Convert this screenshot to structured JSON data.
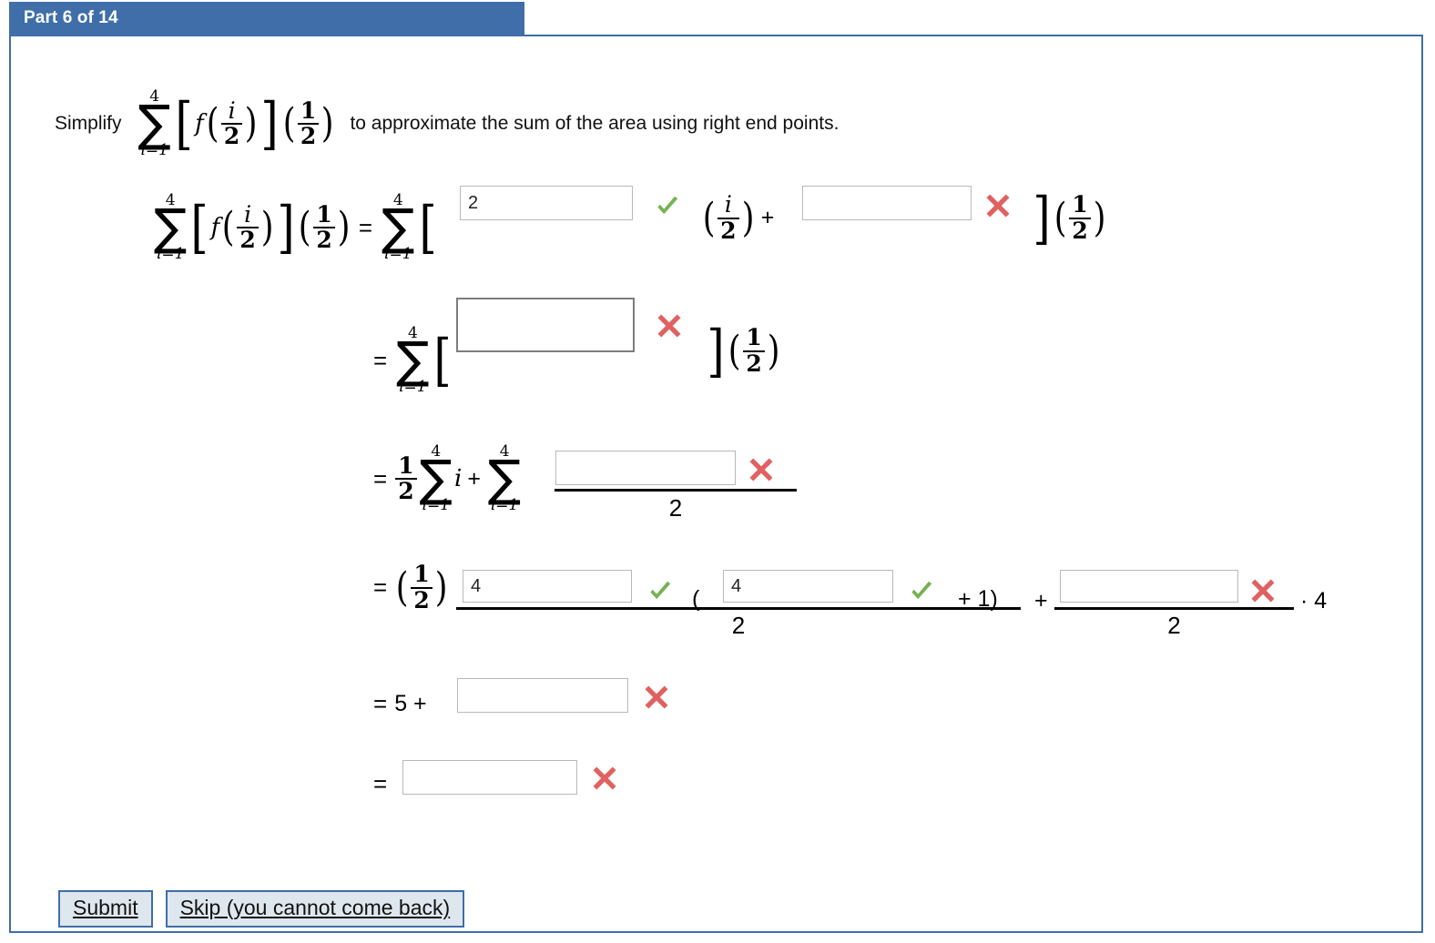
{
  "header": {
    "tab_label": "Part 6 of 14",
    "tab_color": "#3f6ea9"
  },
  "prompt": {
    "lead": "Simplify",
    "trail": "to approximate the sum of the area using right end points.",
    "sum_upper": "4",
    "sum_lower": "i=1",
    "f_symbol": "f",
    "arg_num": "i",
    "arg_den": "2",
    "factor_num": "1",
    "factor_den": "2"
  },
  "marks": {
    "correct_color": "#76b254",
    "incorrect_color": "#e06161",
    "correct_name": "check-icon",
    "incorrect_name": "cross-icon"
  },
  "lines": [
    {
      "id": "line-1",
      "sum_upper": "4",
      "sum_lower": "i=1",
      "equals": "=",
      "input1_value": "2",
      "input1_status": "correct",
      "inner_num": "i",
      "inner_den": "2",
      "plus": "+",
      "input2_value": "",
      "input2_status": "incorrect",
      "tail_num": "1",
      "tail_den": "2"
    },
    {
      "id": "line-2",
      "equals": "=",
      "sum_upper": "4",
      "sum_lower": "i=1",
      "input1_value": "",
      "input1_status": "incorrect",
      "tail_num": "1",
      "tail_den": "2"
    },
    {
      "id": "line-3",
      "equals": "=",
      "coef_num": "1",
      "coef_den": "2",
      "sum1_upper": "4",
      "sum1_lower": "i=1",
      "index_var": "i",
      "plus": "+",
      "sum2_upper": "4",
      "sum2_lower": "i=1",
      "input1_value": "",
      "input1_status": "incorrect",
      "denominator": "2"
    },
    {
      "id": "line-4",
      "equals": "=",
      "coef_num": "1",
      "coef_den": "2",
      "open_paren": "(",
      "input1_value": "4",
      "input1_status": "correct",
      "input2_value": "4",
      "input2_status": "correct",
      "plus_one": "+ 1)",
      "denominator1": "2",
      "plus": "+",
      "input3_value": "",
      "input3_status": "incorrect",
      "denominator2": "2",
      "tail": "· 4"
    },
    {
      "id": "line-5",
      "equals": "=",
      "constant": "5 +",
      "input1_value": "",
      "input1_status": "incorrect"
    },
    {
      "id": "line-6",
      "equals": "=",
      "input1_value": "",
      "input1_status": "incorrect"
    }
  ],
  "buttons": {
    "submit_label": "Submit",
    "skip_label": "Skip (you cannot come back)"
  }
}
